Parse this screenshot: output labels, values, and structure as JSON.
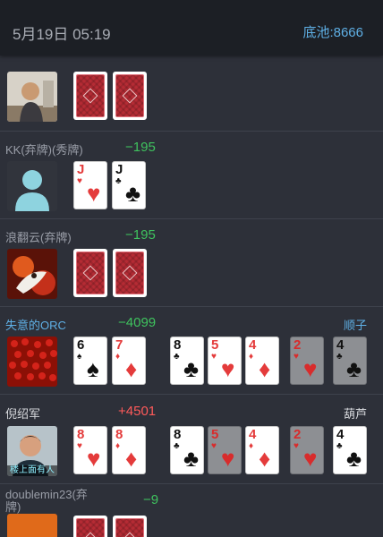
{
  "header": {
    "datetime": "5月19日 05:19",
    "pot": "底池:8666"
  },
  "players": [
    {
      "name": "",
      "score": "",
      "hand": ""
    },
    {
      "name": "KK(弃牌)(秀牌)",
      "score": "−195",
      "hand": ""
    },
    {
      "name": "浪翻云(弃牌)",
      "score": "−195",
      "hand": ""
    },
    {
      "name": "失意的ORC",
      "score": "−4099",
      "hand": "顺子"
    },
    {
      "name": "倪绍军",
      "score": "+4501",
      "hand": "葫芦",
      "avatar_caption": "楼上面有人"
    },
    {
      "name": "doublemin23(弃牌)",
      "score": "−9",
      "hand": ""
    }
  ],
  "cards": {
    "kk": [
      {
        "rank": "J",
        "suit": "♥",
        "color": "red"
      },
      {
        "rank": "J",
        "suit": "♣",
        "color": "black"
      }
    ],
    "orc": [
      {
        "rank": "6",
        "suit": "♠",
        "color": "black"
      },
      {
        "rank": "7",
        "suit": "♦",
        "color": "red"
      }
    ],
    "ni": [
      {
        "rank": "8",
        "suit": "♥",
        "color": "red"
      },
      {
        "rank": "8",
        "suit": "♦",
        "color": "red"
      }
    ],
    "board_orc": [
      {
        "rank": "8",
        "suit": "♣",
        "color": "black",
        "state": "highlighted"
      },
      {
        "rank": "5",
        "suit": "♥",
        "color": "red",
        "state": "highlighted"
      },
      {
        "rank": "4",
        "suit": "♦",
        "color": "red",
        "state": "highlighted"
      },
      {
        "rank": "2",
        "suit": "♥",
        "color": "red",
        "state": "dimmed"
      },
      {
        "rank": "4",
        "suit": "♣",
        "color": "black",
        "state": "dimmed"
      }
    ],
    "board_ni": [
      {
        "rank": "8",
        "suit": "♣",
        "color": "black",
        "state": "highlighted"
      },
      {
        "rank": "5",
        "suit": "♥",
        "color": "red",
        "state": "dimmed"
      },
      {
        "rank": "4",
        "suit": "♦",
        "color": "red",
        "state": "highlighted"
      },
      {
        "rank": "2",
        "suit": "♥",
        "color": "red",
        "state": "dimmed"
      },
      {
        "rank": "4",
        "suit": "♣",
        "color": "black",
        "state": "highlighted"
      }
    ]
  },
  "colors": {
    "background": "#2d3039",
    "header": "#1c1f25",
    "accent_blue": "#5fb0e6",
    "win_red": "#ff5a5a",
    "loss_green": "#3fc25e"
  }
}
